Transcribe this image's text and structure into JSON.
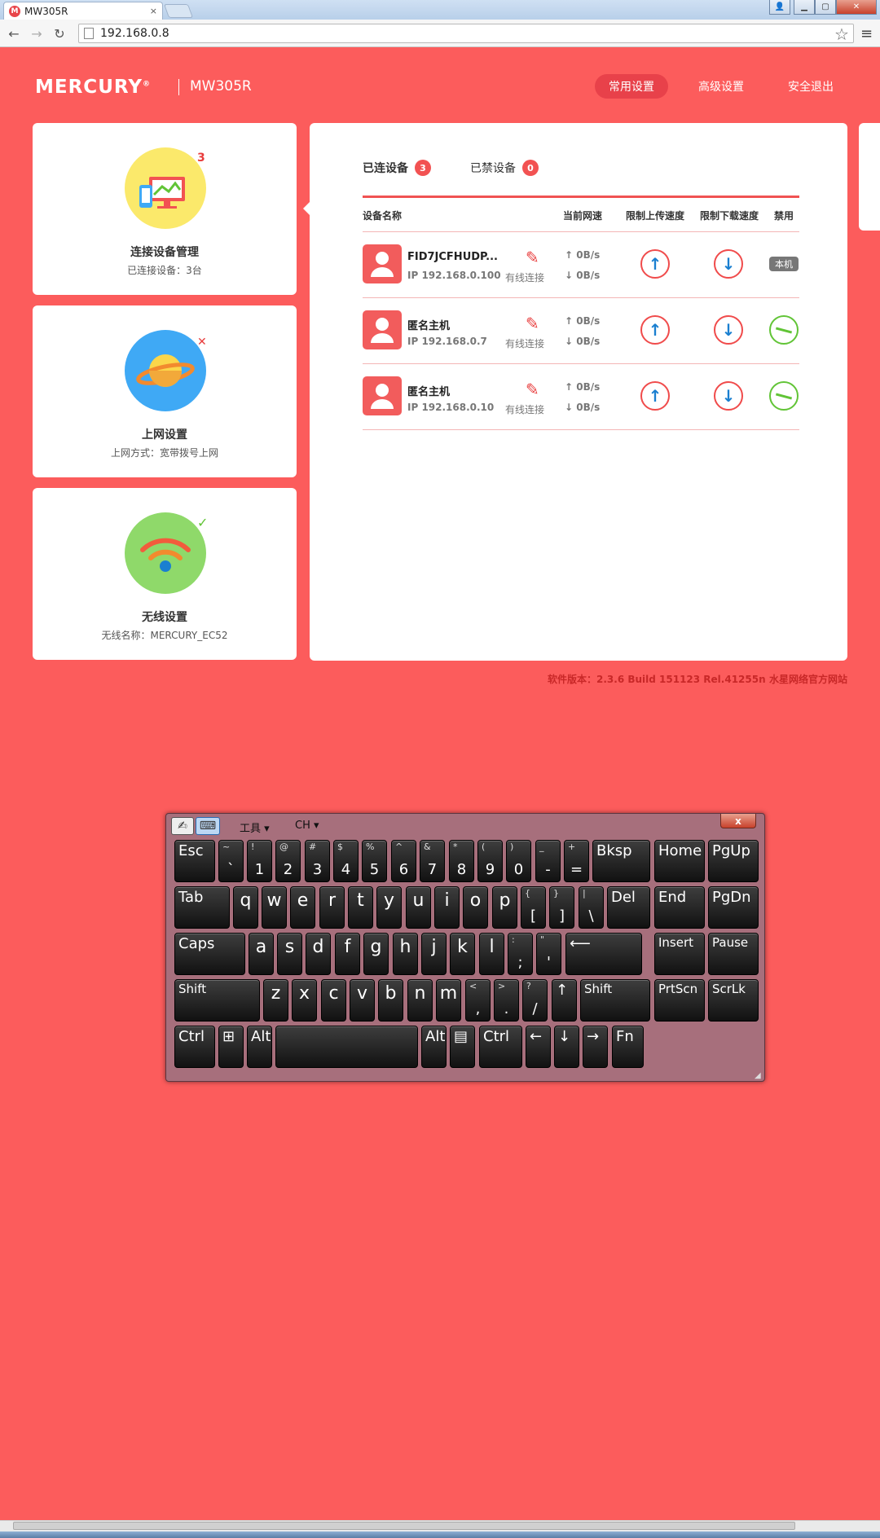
{
  "browser": {
    "tab_title": "MW305R",
    "favicon_letter": "M",
    "tab_close": "×",
    "url": "192.168.0.8",
    "star_icon": "☆",
    "menu_icon": "≡"
  },
  "header": {
    "logo": "MERCURY",
    "logo_mark": "®",
    "model": "MW305R",
    "nav": [
      {
        "label": "常用设置",
        "active": true
      },
      {
        "label": "高级设置",
        "active": false
      },
      {
        "label": "安全退出",
        "active": false
      }
    ]
  },
  "sidebar": {
    "cards": [
      {
        "title": "连接设备管理",
        "subtitle": "已连接设备：3台",
        "badge": "3",
        "icon": "devices-icon"
      },
      {
        "title": "上网设置",
        "subtitle": "上网方式：宽带拨号上网",
        "badge": "✕",
        "icon": "planet-icon"
      },
      {
        "title": "无线设置",
        "subtitle": "无线名称：MERCURY_EC52",
        "badge": "✓",
        "icon": "wifi-icon"
      }
    ]
  },
  "devices": {
    "tabs": [
      {
        "label": "已连设备",
        "count": "3"
      },
      {
        "label": "已禁设备",
        "count": "0"
      }
    ],
    "columns": [
      "设备名称",
      "当前网速",
      "限制上传速度",
      "限制下载速度",
      "禁用"
    ],
    "rows": [
      {
        "name": "FID7JCFHUDP...",
        "ip": "IP 192.168.0.100",
        "conn": "有线连接",
        "up": "0B/s",
        "down": "0B/s",
        "local": true,
        "local_label": "本机"
      },
      {
        "name": "匿名主机",
        "ip": "IP 192.168.0.7",
        "conn": "有线连接",
        "up": "0B/s",
        "down": "0B/s",
        "local": false
      },
      {
        "name": "匿名主机",
        "ip": "IP 192.168.0.10",
        "conn": "有线连接",
        "up": "0B/s",
        "down": "0B/s",
        "local": false
      }
    ]
  },
  "footer": {
    "version": "软件版本：2.3.6 Build 151123 Rel.41255n",
    "site": "水星网络官方网站"
  },
  "osk": {
    "menu_tools": "工具",
    "menu_lang": "CH",
    "close": "x",
    "row1": [
      {
        "s": "",
        "m": "Esc"
      },
      {
        "s": "~",
        "m": "`"
      },
      {
        "s": "!",
        "m": "1"
      },
      {
        "s": "@",
        "m": "2"
      },
      {
        "s": "#",
        "m": "3"
      },
      {
        "s": "$",
        "m": "4"
      },
      {
        "s": "%",
        "m": "5"
      },
      {
        "s": "^",
        "m": "6"
      },
      {
        "s": "&",
        "m": "7"
      },
      {
        "s": "*",
        "m": "8"
      },
      {
        "s": "(",
        "m": "9"
      },
      {
        "s": ")",
        "m": "0"
      },
      {
        "s": "_",
        "m": "-"
      },
      {
        "s": "+",
        "m": "="
      },
      {
        "s": "",
        "m": "Bksp"
      },
      {
        "s": "",
        "m": "Home"
      },
      {
        "s": "",
        "m": "PgUp"
      }
    ],
    "row2": [
      {
        "s": "",
        "m": "Tab"
      },
      {
        "s": "",
        "m": "q"
      },
      {
        "s": "",
        "m": "w"
      },
      {
        "s": "",
        "m": "e"
      },
      {
        "s": "",
        "m": "r"
      },
      {
        "s": "",
        "m": "t"
      },
      {
        "s": "",
        "m": "y"
      },
      {
        "s": "",
        "m": "u"
      },
      {
        "s": "",
        "m": "i"
      },
      {
        "s": "",
        "m": "o"
      },
      {
        "s": "",
        "m": "p"
      },
      {
        "s": "{",
        "m": "["
      },
      {
        "s": "}",
        "m": "]"
      },
      {
        "s": "|",
        "m": "\\"
      },
      {
        "s": "",
        "m": "Del"
      },
      {
        "s": "",
        "m": "End"
      },
      {
        "s": "",
        "m": "PgDn"
      }
    ],
    "row3": [
      {
        "s": "",
        "m": "Caps"
      },
      {
        "s": "",
        "m": "a"
      },
      {
        "s": "",
        "m": "s"
      },
      {
        "s": "",
        "m": "d"
      },
      {
        "s": "",
        "m": "f"
      },
      {
        "s": "",
        "m": "g"
      },
      {
        "s": "",
        "m": "h"
      },
      {
        "s": "",
        "m": "j"
      },
      {
        "s": "",
        "m": "k"
      },
      {
        "s": "",
        "m": "l"
      },
      {
        "s": ":",
        "m": ";"
      },
      {
        "s": "\"",
        "m": "'"
      },
      {
        "s": "",
        "m": "⟵"
      },
      {
        "s": "",
        "m": "Insert"
      },
      {
        "s": "",
        "m": "Pause"
      }
    ],
    "row4": [
      {
        "s": "",
        "m": "Shift"
      },
      {
        "s": "",
        "m": "z"
      },
      {
        "s": "",
        "m": "x"
      },
      {
        "s": "",
        "m": "c"
      },
      {
        "s": "",
        "m": "v"
      },
      {
        "s": "",
        "m": "b"
      },
      {
        "s": "",
        "m": "n"
      },
      {
        "s": "",
        "m": "m"
      },
      {
        "s": "<",
        "m": ","
      },
      {
        "s": ">",
        "m": "."
      },
      {
        "s": "?",
        "m": "/"
      },
      {
        "s": "",
        "m": "↑"
      },
      {
        "s": "",
        "m": "Shift"
      },
      {
        "s": "",
        "m": "PrtScn"
      },
      {
        "s": "",
        "m": "ScrLk"
      }
    ],
    "row5": [
      {
        "s": "",
        "m": "Ctrl"
      },
      {
        "s": "",
        "m": "⊞"
      },
      {
        "s": "",
        "m": "Alt"
      },
      {
        "s": "",
        "m": ""
      },
      {
        "s": "",
        "m": "Alt"
      },
      {
        "s": "",
        "m": "▤"
      },
      {
        "s": "",
        "m": "Ctrl"
      },
      {
        "s": "",
        "m": "←"
      },
      {
        "s": "",
        "m": "↓"
      },
      {
        "s": "",
        "m": "→"
      },
      {
        "s": "",
        "m": "Fn"
      }
    ]
  },
  "colors": {
    "background": "#fc5c5c",
    "accent": "#e8414a",
    "green": "#61c436",
    "blue_arrow": "#1a7fd0"
  }
}
